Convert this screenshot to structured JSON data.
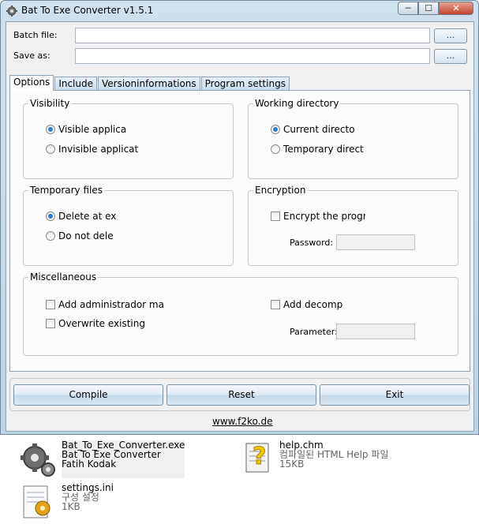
{
  "window": {
    "title": "Bat To Exe Converter v1.5.1",
    "controls": {
      "minimize": "─",
      "maximize": "☐",
      "close": "✕"
    }
  },
  "fields": {
    "batch_label": "Batch file:",
    "batch_value": "",
    "save_label": "Save as:",
    "save_value": "",
    "browse_label": "..."
  },
  "tabs": [
    "Options",
    "Include",
    "Versioninformations",
    "Program settings"
  ],
  "groups": {
    "visibility": {
      "title": "Visibility",
      "options": [
        {
          "label": "Visible applica",
          "checked": true
        },
        {
          "label": "Invisible applicat",
          "checked": false
        }
      ]
    },
    "working_directory": {
      "title": "Working directory",
      "options": [
        {
          "label": "Current directo",
          "checked": true
        },
        {
          "label": "Temporary direct",
          "checked": false
        }
      ]
    },
    "temporary_files": {
      "title": "Temporary files",
      "options": [
        {
          "label": "Delete at ex",
          "checked": true
        },
        {
          "label": "Do not dele",
          "checked": false
        }
      ]
    },
    "encryption": {
      "title": "Encryption",
      "checkbox": "Encrypt the progr",
      "password_label": "Password:"
    },
    "miscellaneous": {
      "title": "Miscellaneous",
      "checkboxes": [
        "Add administrador man",
        "Overwrite existing fi",
        "Add decomp"
      ],
      "parameter_label": "Parameter:"
    }
  },
  "buttons": {
    "compile": "Compile",
    "reset": "Reset",
    "exit": "Exit"
  },
  "link": "www.f2ko.de",
  "desktop": {
    "files": [
      {
        "lines": [
          "Bat_To_Exe_Converter.exe",
          "Bat To Exe Converter",
          "Fatih Kodak"
        ],
        "icon": "gears-icon"
      },
      {
        "lines": [
          "help.chm",
          "컴파일된 HTML Help 파일",
          "15KB"
        ],
        "icon": "help-file-icon"
      },
      {
        "lines": [
          "settings.ini",
          "구성 설정",
          "1KB"
        ],
        "icon": "config-file-icon"
      }
    ]
  }
}
